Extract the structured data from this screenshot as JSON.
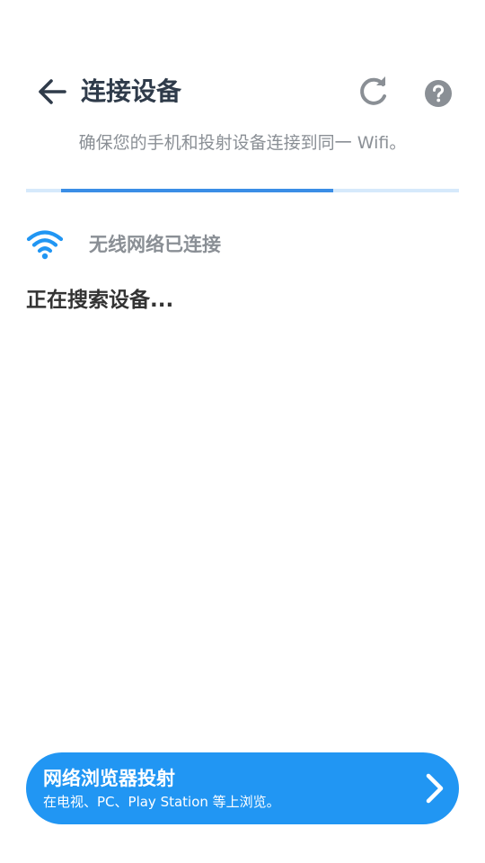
{
  "header": {
    "title": "连接设备",
    "back_icon": "arrow-left-icon",
    "refresh_icon": "refresh-icon",
    "help_icon": "help-circle-icon"
  },
  "subtitle": "确保您的手机和投射设备连接到同一 Wifi。",
  "progress": {
    "start": 0.08,
    "end": 0.71,
    "fill_color": "#3a8ee6",
    "track_color": "#d6e9fb"
  },
  "wifi_status": {
    "icon": "wifi-icon",
    "label": "无线网络已连接",
    "icon_color": "#2196f3"
  },
  "searching_text": "正在搜索设备...",
  "browser_cast": {
    "title": "网络浏览器投射",
    "description": "在电视、PC、Play Station 等上浏览。",
    "icon": "chevron-right-icon",
    "background_color": "#2196f3"
  },
  "colors": {
    "accent": "#2196f3",
    "title_text": "#2f3b4a",
    "secondary_text": "#8a8f95",
    "icon_gray": "#8a8f95"
  }
}
